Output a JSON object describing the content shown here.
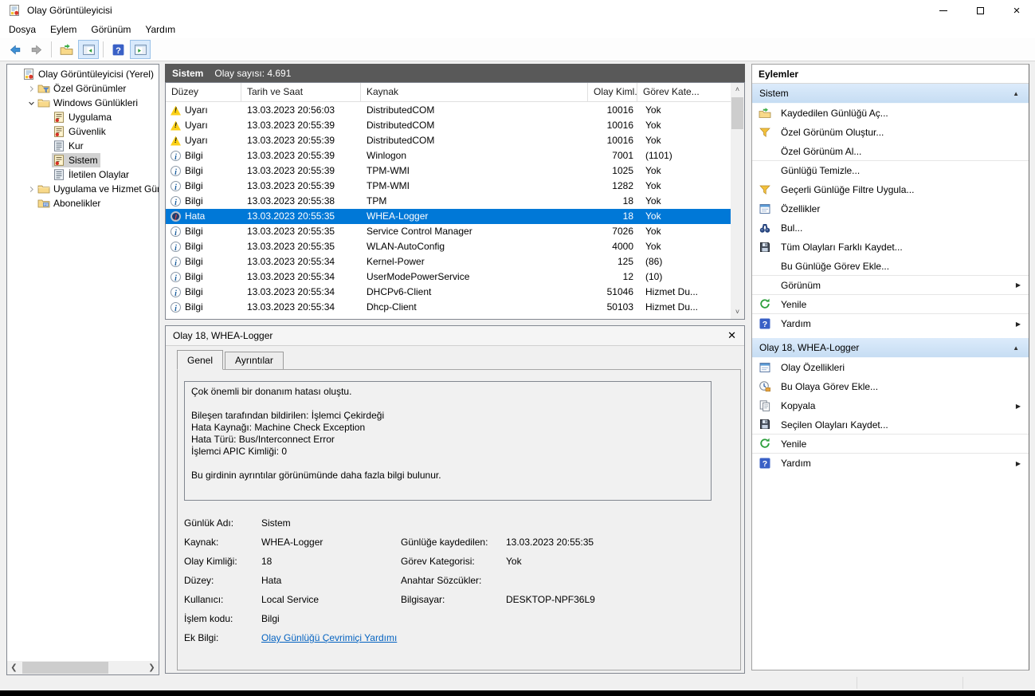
{
  "window": {
    "title": "Olay Görüntüleyicisi"
  },
  "menu": {
    "items": [
      {
        "label": "Dosya"
      },
      {
        "label": "Eylem"
      },
      {
        "label": "Görünüm"
      },
      {
        "label": "Yardım"
      }
    ]
  },
  "toolbar": {
    "buttons": [
      "back",
      "forward",
      "export-log",
      "console-tree-toggle",
      "help",
      "action-pane-toggle"
    ]
  },
  "tree": {
    "items": [
      {
        "label": "Olay Görüntüleyicisi (Yerel)",
        "icon": "event-viewer",
        "chevron": "",
        "indent": 0
      },
      {
        "label": "Özel Görünümler",
        "icon": "folder-filter",
        "chevron": "chevron-collapsed",
        "indent": 1
      },
      {
        "label": "Windows Günlükleri",
        "icon": "folder",
        "chevron": "chevron-expanded",
        "indent": 1
      },
      {
        "label": "Uygulama",
        "icon": "log-event",
        "chevron": "",
        "indent": 2
      },
      {
        "label": "Güvenlik",
        "icon": "log-event",
        "chevron": "",
        "indent": 2
      },
      {
        "label": "Kur",
        "icon": "log",
        "chevron": "",
        "indent": 2
      },
      {
        "label": "Sistem",
        "icon": "log-event",
        "chevron": "",
        "indent": 2,
        "selected": true
      },
      {
        "label": "İletilen Olaylar",
        "icon": "log",
        "chevron": "",
        "indent": 2
      },
      {
        "label": "Uygulama ve Hizmet Günlük",
        "icon": "folder",
        "chevron": "chevron-collapsed",
        "indent": 1
      },
      {
        "label": "Abonelikler",
        "icon": "subscriptions",
        "chevron": "",
        "indent": 1
      }
    ]
  },
  "events": {
    "log_name": "Sistem",
    "count_label": "Olay sayısı: 4.691",
    "columns": [
      "Düzey",
      "Tarih ve Saat",
      "Kaynak",
      "Olay Kiml...",
      "Görev Kate..."
    ],
    "rows": [
      {
        "level": "Uyarı",
        "type": "warning",
        "date": "13.03.2023 20:56:03",
        "source": "DistributedCOM",
        "id": "10016",
        "task": "Yok"
      },
      {
        "level": "Uyarı",
        "type": "warning",
        "date": "13.03.2023 20:55:39",
        "source": "DistributedCOM",
        "id": "10016",
        "task": "Yok"
      },
      {
        "level": "Uyarı",
        "type": "warning",
        "date": "13.03.2023 20:55:39",
        "source": "DistributedCOM",
        "id": "10016",
        "task": "Yok"
      },
      {
        "level": "Bilgi",
        "type": "info",
        "date": "13.03.2023 20:55:39",
        "source": "Winlogon",
        "id": "7001",
        "task": "(1101)"
      },
      {
        "level": "Bilgi",
        "type": "info",
        "date": "13.03.2023 20:55:39",
        "source": "TPM-WMI",
        "id": "1025",
        "task": "Yok"
      },
      {
        "level": "Bilgi",
        "type": "info",
        "date": "13.03.2023 20:55:39",
        "source": "TPM-WMI",
        "id": "1282",
        "task": "Yok"
      },
      {
        "level": "Bilgi",
        "type": "info",
        "date": "13.03.2023 20:55:38",
        "source": "TPM",
        "id": "18",
        "task": "Yok"
      },
      {
        "level": "Hata",
        "type": "error",
        "date": "13.03.2023 20:55:35",
        "source": "WHEA-Logger",
        "id": "18",
        "task": "Yok",
        "selected": true
      },
      {
        "level": "Bilgi",
        "type": "info",
        "date": "13.03.2023 20:55:35",
        "source": "Service Control Manager",
        "id": "7026",
        "task": "Yok"
      },
      {
        "level": "Bilgi",
        "type": "info",
        "date": "13.03.2023 20:55:35",
        "source": "WLAN-AutoConfig",
        "id": "4000",
        "task": "Yok"
      },
      {
        "level": "Bilgi",
        "type": "info",
        "date": "13.03.2023 20:55:34",
        "source": "Kernel-Power",
        "id": "125",
        "task": "(86)"
      },
      {
        "level": "Bilgi",
        "type": "info",
        "date": "13.03.2023 20:55:34",
        "source": "UserModePowerService",
        "id": "12",
        "task": "(10)"
      },
      {
        "level": "Bilgi",
        "type": "info",
        "date": "13.03.2023 20:55:34",
        "source": "DHCPv6-Client",
        "id": "51046",
        "task": "Hizmet Du..."
      },
      {
        "level": "Bilgi",
        "type": "info",
        "date": "13.03.2023 20:55:34",
        "source": "Dhcp-Client",
        "id": "50103",
        "task": "Hizmet Du..."
      }
    ]
  },
  "details": {
    "title": "Olay 18, WHEA-Logger",
    "close_glyph": "✕",
    "tabs": [
      {
        "label": "Genel"
      },
      {
        "label": "Ayrıntılar"
      }
    ],
    "active_tab": "Genel",
    "description": "Çok önemli bir donanım hatası oluştu.\n\nBileşen tarafından bildirilen: İşlemci Çekirdeği\nHata Kaynağı: Machine Check Exception\nHata Türü: Bus/Interconnect Error\nİşlemci APIC Kimliği: 0\n\nBu girdinin ayrıntılar görünümünde daha fazla bilgi bulunur.",
    "fields": [
      {
        "l_label": "Günlük Adı:",
        "l_value": "Sistem",
        "r_label": "",
        "r_value": ""
      },
      {
        "l_label": "Kaynak:",
        "l_value": "WHEA-Logger",
        "r_label": "Günlüğe kaydedilen:",
        "r_value": "13.03.2023 20:55:35"
      },
      {
        "l_label": "Olay Kimliği:",
        "l_value": "18",
        "r_label": "Görev Kategorisi:",
        "r_value": "Yok"
      },
      {
        "l_label": "Düzey:",
        "l_value": "Hata",
        "r_label": "Anahtar Sözcükler:",
        "r_value": ""
      },
      {
        "l_label": "Kullanıcı:",
        "l_value": "Local Service",
        "r_label": "Bilgisayar:",
        "r_value": "DESKTOP-NPF36L9"
      },
      {
        "l_label": "İşlem kodu:",
        "l_value": "Bilgi",
        "r_label": "",
        "r_value": ""
      }
    ],
    "extra_label": "Ek Bilgi:",
    "extra_link": "Olay Günlüğü Çevrimiçi Yardımı"
  },
  "actions": {
    "header": "Eylemler",
    "sections": [
      {
        "title": "Sistem",
        "items": [
          {
            "label": "Kaydedilen Günlüğü Aç...",
            "icon": "open-log"
          },
          {
            "label": "Özel Görünüm Oluştur...",
            "icon": "filter"
          },
          {
            "label": "Özel Görünüm Al...",
            "icon": "",
            "sep_after": true
          },
          {
            "label": "Günlüğü Temizle...",
            "icon": ""
          },
          {
            "label": "Geçerli Günlüğe Filtre Uygula...",
            "icon": "filter"
          },
          {
            "label": "Özellikler",
            "icon": "properties"
          },
          {
            "label": "Bul...",
            "icon": "find"
          },
          {
            "label": "Tüm Olayları Farklı Kaydet...",
            "icon": "save"
          },
          {
            "label": "Bu Günlüğe Görev Ekle...",
            "icon": "",
            "sep_after": true
          },
          {
            "label": "Görünüm",
            "icon": "",
            "submenu": true,
            "sep_after": true
          },
          {
            "label": "Yenile",
            "icon": "refresh",
            "sep_after": true
          },
          {
            "label": "Yardım",
            "icon": "help",
            "submenu": true
          }
        ]
      },
      {
        "title": "Olay 18, WHEA-Logger",
        "items": [
          {
            "label": "Olay Özellikleri",
            "icon": "properties"
          },
          {
            "label": "Bu Olaya Görev Ekle...",
            "icon": "task-clock"
          },
          {
            "label": "Kopyala",
            "icon": "copy",
            "submenu": true
          },
          {
            "label": "Seçilen Olayları Kaydet...",
            "icon": "save",
            "sep_after": true
          },
          {
            "label": "Yenile",
            "icon": "refresh",
            "sep_after": true
          },
          {
            "label": "Yardım",
            "icon": "help",
            "submenu": true
          }
        ]
      }
    ]
  },
  "colors": {
    "selection": "#0078d7",
    "list_caption_bg": "#595959",
    "section_header_bg": "#cde3f7",
    "warning": "#fcd017",
    "error_ring": "#b9c0cb",
    "link": "#0563c1"
  }
}
